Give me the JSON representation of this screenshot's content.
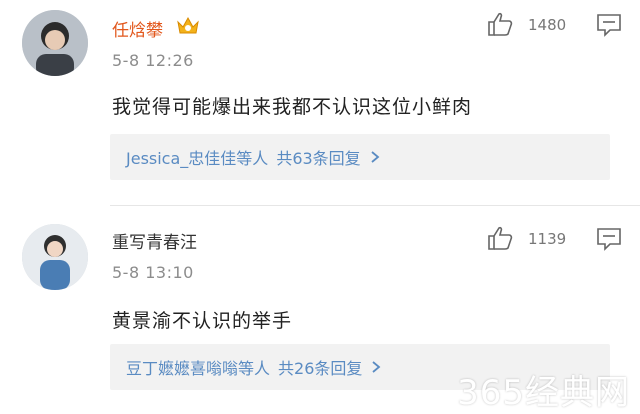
{
  "comments": [
    {
      "username": "任焓攀",
      "time": "5-8 12:26",
      "text": "我觉得可能爆出来我都不认识这位小鲜肉",
      "like_count": "1480",
      "replies_user": "Jessica_忠佳佳",
      "replies_suffix": "等人",
      "replies_total": "共63条回复",
      "username_color": "#e2571c",
      "icons": [
        "avatar",
        "vip-crown-badge",
        "thumbs-up-icon",
        "comment-icon",
        "chevron-right-icon"
      ]
    },
    {
      "username": "重写青春汪",
      "time": "5-8 13:10",
      "text": "黄景渝不认识的举手",
      "like_count": "1139",
      "replies_user": "豆丁嬷嬷喜嗡嗡",
      "replies_suffix": "等人",
      "replies_total": "共26条回复",
      "username_color": "#333333",
      "icons": [
        "avatar",
        "thumbs-up-icon",
        "comment-icon",
        "chevron-right-icon"
      ]
    }
  ],
  "watermark": "365经典网",
  "colors": {
    "link": "#5a8bc2",
    "meta": "#8c8c8c",
    "reply_bg": "#f2f2f2"
  }
}
